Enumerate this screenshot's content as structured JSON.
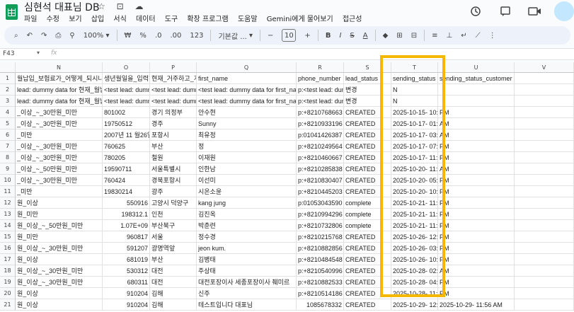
{
  "app": {
    "doc_title": "심현석 대표님 DB",
    "title_icons": "☆ ⊡ ☁",
    "menu": [
      "파일",
      "수정",
      "보기",
      "삽입",
      "서식",
      "데이터",
      "도구",
      "확장 프로그램",
      "도움말",
      "Gemini에게 물어보기",
      "접근성"
    ],
    "top_icons": [
      "history-icon",
      "comment-icon",
      "video-icon"
    ]
  },
  "toolbar": {
    "search": "⌕",
    "undo": "↶",
    "redo": "↷",
    "print": "⎙",
    "paint_format": "⚲",
    "zoom": "100%",
    "zoom_arrow": "▾",
    "currency": "₩",
    "percent": "%",
    "dec_decrease": ".0",
    "dec_increase": ".00",
    "number_format": "123",
    "font": "기본값 ...",
    "font_arrow": "▾",
    "font_size_minus": "−",
    "font_size": "10",
    "font_size_plus": "+",
    "bold": "B",
    "italic": "I",
    "strike": "S",
    "text_color": "A",
    "fill": "◆",
    "borders": "⊞",
    "merge": "⊟",
    "halign": "≡",
    "valign": "⊥",
    "wrap": "↵",
    "rotate": "⟋",
    "more": "⋮"
  },
  "formula_bar": {
    "cell_ref": "F43",
    "arrow": "▾",
    "fx": "fx",
    "value": ""
  },
  "columns": [
    "N",
    "O",
    "P",
    "Q",
    "R",
    "S",
    "T",
    "U",
    "V"
  ],
  "rows": [
    {
      "num": "1",
      "cells": [
        "월납입_보험료가_어떻게_되시나",
        "생년월일을_입력하",
        "현재_거주하고_계",
        "first_name",
        "phone_number",
        "lead_status",
        "sending_status",
        "sending_status_customer",
        ""
      ]
    },
    {
      "num": "2",
      "cells": [
        "lead: dummy data for 현재_월납",
        "<test lead: dumm",
        "<test lead: dumm",
        "<test lead: dummy data for first_na",
        "p:<test lead: dum",
        "변경",
        "N",
        "",
        ""
      ]
    },
    {
      "num": "3",
      "cells": [
        "lead: dummy data for 현재_월납",
        "<test lead: dumm",
        "<test lead: dumm",
        "<test lead: dummy data for first_na",
        "p:<test lead: dum",
        "변경",
        "N",
        "",
        ""
      ]
    },
    {
      "num": "4",
      "cells": [
        "_이상_~_30만원_미만",
        "801002",
        "경기 의정부",
        "안수현",
        "p:+8210768663",
        "CREATED",
        "2025-10-15- 10:3",
        "PM",
        ""
      ]
    },
    {
      "num": "5",
      "cells": [
        "_이상_~_30만원_미만",
        "19750512",
        "경주",
        "Sunny",
        "p:+8210933196",
        "CREATED",
        "2025-10-17- 01:1",
        "AM",
        ""
      ]
    },
    {
      "num": "6",
      "cells": [
        "_미만",
        "2007년 11 월26일",
        "포항시",
        "최유정",
        "p:01041426387",
        "CREATED",
        "2025-10-17- 03:5",
        "AM",
        ""
      ]
    },
    {
      "num": "7",
      "cells": [
        "_이상_~_30만원_미만",
        "760625",
        "부산",
        "정",
        "p:+8210249564",
        "CREATED",
        "2025-10-17- 07:0",
        "PM",
        ""
      ]
    },
    {
      "num": "8",
      "cells": [
        "_이상_~_30만원_미만",
        "780205",
        "철원",
        "이재원",
        "p:+8210460667",
        "CREATED",
        "2025-10-17- 11:3",
        "PM",
        ""
      ]
    },
    {
      "num": "9",
      "cells": [
        "_이상_~_50만원_미만",
        "19590711",
        "서울특별시",
        "인한남",
        "p:+8210285838",
        "CREATED",
        "2025-10-20- 11:0",
        "AM",
        ""
      ]
    },
    {
      "num": "10",
      "cells": [
        "_이상_~_30만원_미만",
        "760424",
        "경북포항시",
        "이선미",
        "p:+8210830407",
        "CREATED",
        "2025-10-20- 05:3",
        "PM",
        ""
      ]
    },
    {
      "num": "11",
      "cells": [
        "_미만",
        "19830214",
        "광주",
        "시온소윤",
        "p:+8210445203",
        "CREATED",
        "2025-10-20- 10:4",
        "PM",
        ""
      ]
    },
    {
      "num": "12",
      "cells": [
        "원_이상",
        "550916",
        "고양시 덕양구",
        "kang jung",
        "p:01053043590",
        "complete",
        "2025-10-21- 11:0",
        "PM",
        ""
      ]
    },
    {
      "num": "13",
      "cells": [
        "원_미만",
        "198312.1",
        "인천",
        "김진옥",
        "p:+8210994296",
        "complete",
        "2025-10-21- 11:0",
        "PM",
        ""
      ]
    },
    {
      "num": "14",
      "cells": [
        "원_이상_~_50만원_미만",
        "1.07E+09",
        "부산북구",
        "박춘련",
        "p:+8210732806",
        "complete",
        "2025-10-21- 11:0",
        "PM",
        ""
      ]
    },
    {
      "num": "15",
      "cells": [
        "원_미만",
        "960817",
        "서울",
        "정수경",
        "p:+8210215768",
        "CREATED",
        "2025-10-26- 12:5",
        "PM",
        ""
      ]
    },
    {
      "num": "16",
      "cells": [
        "원_이상_~_30만원_미만",
        "591207",
        "광명역앞",
        "jeon kum.",
        "p:+8210882856",
        "CREATED",
        "2025-10-26- 03:5",
        "PM",
        ""
      ]
    },
    {
      "num": "17",
      "cells": [
        "원_이상",
        "681019",
        "부산",
        "김병태",
        "p:+8210484548",
        "CREATED",
        "2025-10-26- 10:0",
        "PM",
        ""
      ]
    },
    {
      "num": "18",
      "cells": [
        "원_이상_~_30만원_미만",
        "530312",
        "대전",
        "주상태",
        "p:+8210540996",
        "CREATED",
        "2025-10-28- 02:2",
        "AM",
        ""
      ]
    },
    {
      "num": "19",
      "cells": [
        "원_이상_~_30만원_미만",
        "680311",
        "대전",
        "대전포장이사 세종포장이사 췌미르",
        "p:+8210882533",
        "CREATED",
        "2025-10-28- 04:0",
        "PM",
        ""
      ]
    },
    {
      "num": "20",
      "cells": [
        "원_이상",
        "910204",
        "김해",
        "신주",
        "p:+8210514186",
        "CREATED",
        "2025-10-28- 11:3",
        "PM",
        ""
      ]
    },
    {
      "num": "21",
      "cells": [
        "원_이상",
        "910204",
        "김해",
        "테스트입니다 대표님",
        "1085678332",
        "CREATED",
        "2025-10-29- 12:",
        "2025-10-29- 11:56 AM",
        ""
      ]
    }
  ]
}
